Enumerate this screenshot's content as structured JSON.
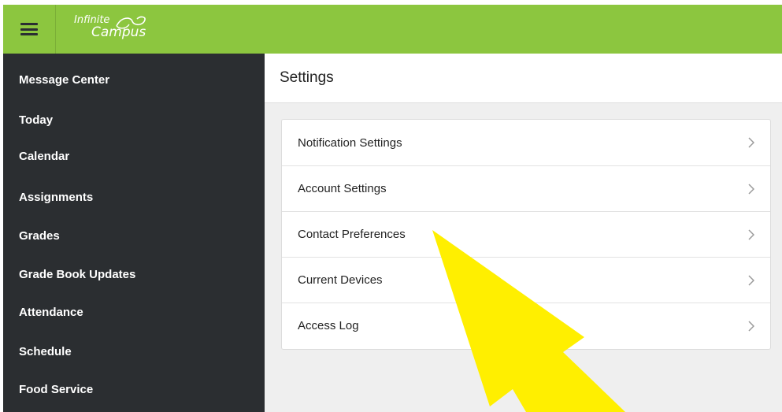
{
  "header": {
    "logo_line1": "Infinite",
    "logo_line2": "Campus",
    "bar_color": "#8cc63f"
  },
  "sidebar": {
    "items": [
      {
        "label": "Message Center"
      },
      {
        "label": "Today"
      },
      {
        "label": "Calendar"
      },
      {
        "label": "Assignments"
      },
      {
        "label": "Grades"
      },
      {
        "label": "Grade Book Updates"
      },
      {
        "label": "Attendance"
      },
      {
        "label": "Schedule"
      },
      {
        "label": "Food Service"
      }
    ]
  },
  "main": {
    "title": "Settings",
    "settings_list": [
      {
        "label": "Notification Settings",
        "icon": "chevron-right-icon"
      },
      {
        "label": "Account Settings",
        "icon": "chevron-right-icon"
      },
      {
        "label": "Contact Preferences",
        "icon": "chevron-right-icon"
      },
      {
        "label": "Current Devices",
        "icon": "chevron-right-icon"
      },
      {
        "label": "Access Log",
        "icon": "chevron-right-icon"
      }
    ]
  },
  "annotation": {
    "icon": "yellow-arrow-icon",
    "color": "#ffef00"
  }
}
